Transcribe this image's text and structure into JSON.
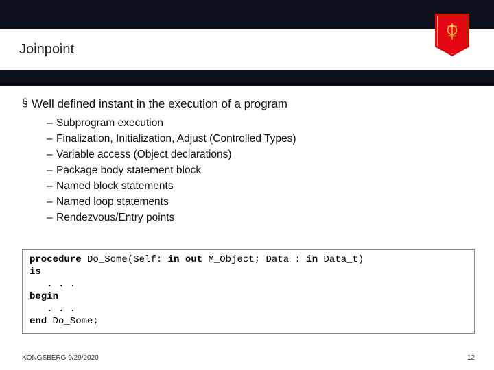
{
  "brand": {
    "name": "KONGSBERG"
  },
  "slide": {
    "title": "Joinpoint",
    "main_bullet": "Well defined instant in the execution of a program",
    "sub_bullets": [
      "Subprogram execution",
      "Finalization, Initialization, Adjust (Controlled Types)",
      "Variable access (Object declarations)",
      "Package body statement block",
      "Named block statements",
      "Named loop statements",
      "Rendezvous/Entry points"
    ],
    "code": {
      "l1a": "procedure",
      "l1b": " Do_Some(Self: ",
      "l1c": "in out",
      "l1d": " M_Object; Data : ",
      "l1e": "in",
      "l1f": " Data_t)",
      "l2": "is",
      "l3": "   . . .",
      "l4": "begin",
      "l5": "   . . .",
      "l6a": "end",
      "l6b": " Do_Some;"
    }
  },
  "footer": {
    "left": "KONGSBERG 9/29/2020",
    "right": "12"
  }
}
